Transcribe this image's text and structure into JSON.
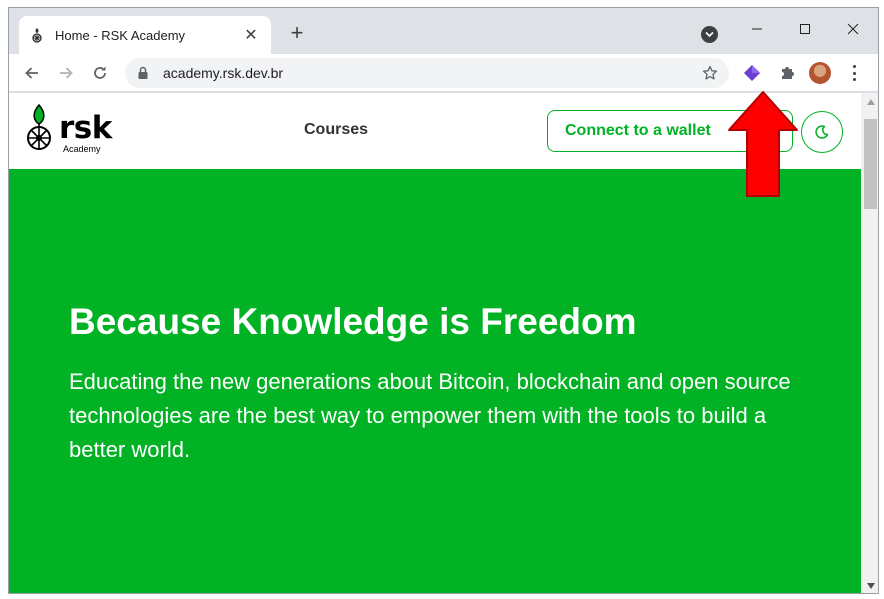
{
  "browser": {
    "tab": {
      "title": "Home - RSK Academy",
      "favicon": "rsk-tree-icon",
      "close_glyph": "✕"
    },
    "new_tab_glyph": "+",
    "window_controls": {
      "minimize": "—",
      "maximize": "☐",
      "close": "✕"
    },
    "address": {
      "url": "academy.rsk.dev.br"
    },
    "icons": {
      "back": "arrow-left-icon",
      "forward": "arrow-right-icon",
      "reload": "reload-icon",
      "lock": "lock-icon",
      "bookmark": "star-icon",
      "extension": "purple-gem-extension-icon",
      "extensions_menu": "puzzle-icon",
      "profile": "avatar",
      "menu": "kebab-menu-icon"
    }
  },
  "site": {
    "logo": {
      "brand": "rsk",
      "sub": "Academy"
    },
    "nav": {
      "courses": "Courses"
    },
    "connect_button": "Connect to a wallet",
    "theme_toggle": "moon-icon",
    "hero": {
      "title": "Because Knowledge is Freedom",
      "text": "Educating the new generations about Bitcoin, blockchain and open source technologies are the best way to empower them with the tools to build a better world."
    }
  },
  "colors": {
    "brand_green": "#00b224",
    "annotation_arrow": "#ff0000",
    "chrome_frame": "#dee1e6"
  }
}
